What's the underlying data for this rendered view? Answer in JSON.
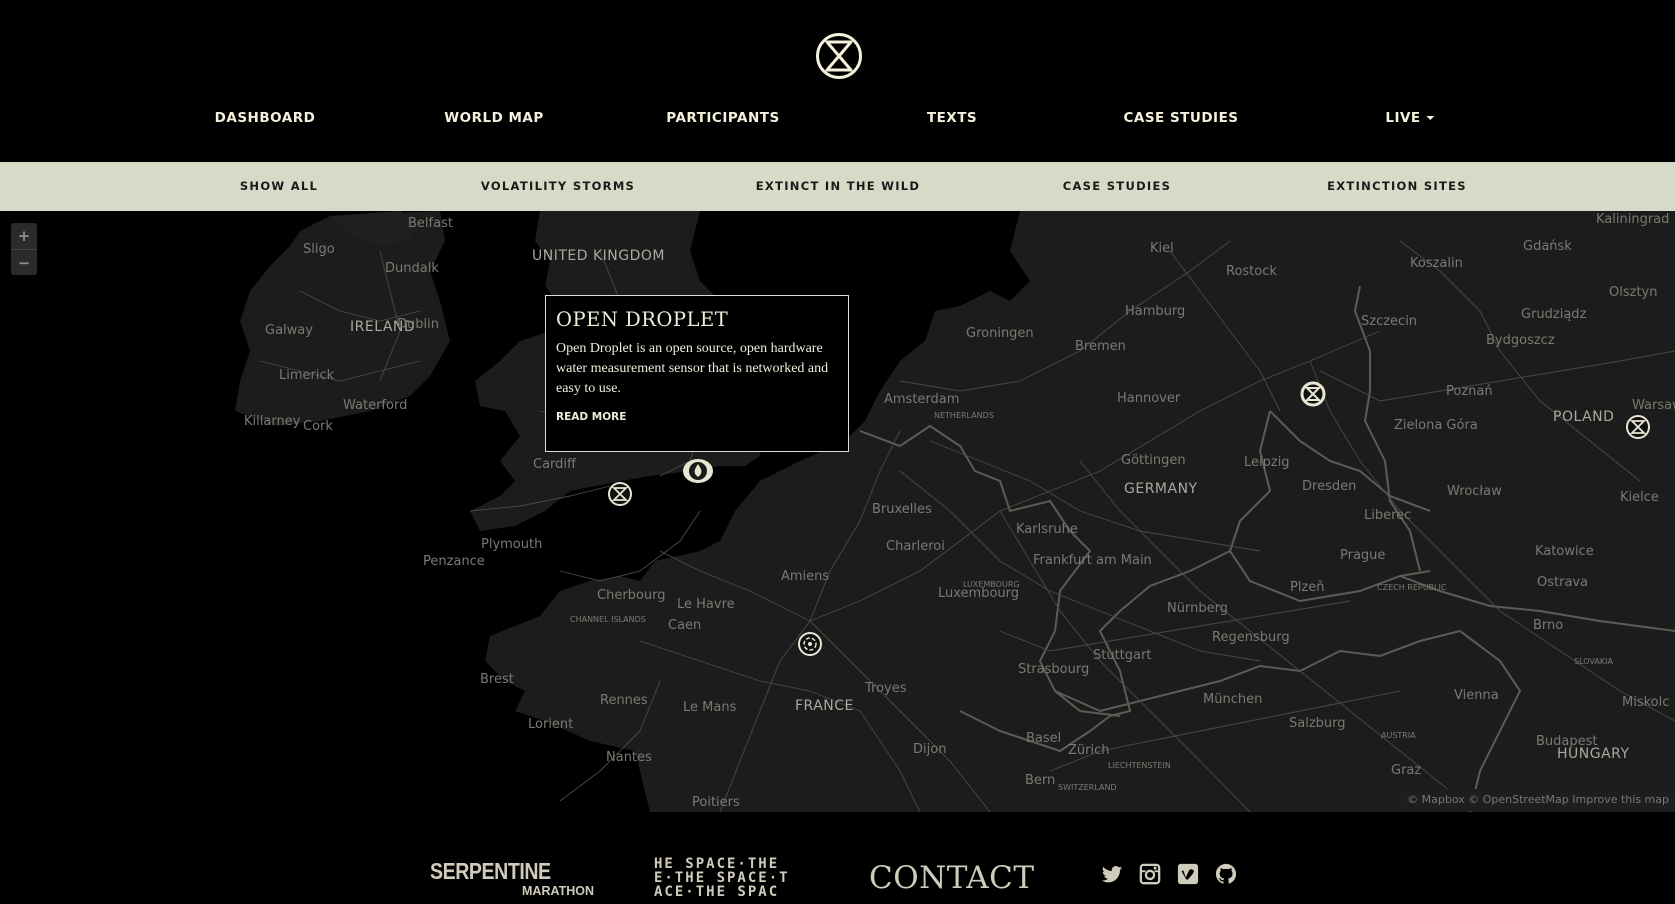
{
  "header": {
    "logo": "extinction-hourglass-icon",
    "nav": [
      {
        "label": "DASHBOARD"
      },
      {
        "label": "WORLD MAP"
      },
      {
        "label": "PARTICIPANTS"
      },
      {
        "label": "TEXTS"
      },
      {
        "label": "CASE STUDIES"
      },
      {
        "label": "LIVE",
        "dropdown": true
      }
    ]
  },
  "filters": [
    {
      "label": "SHOW ALL"
    },
    {
      "label": "VOLATILITY STORMS"
    },
    {
      "label": "EXTINCT IN THE WILD"
    },
    {
      "label": "CASE STUDIES"
    },
    {
      "label": "EXTINCTION SITES"
    }
  ],
  "map": {
    "zoom_in": "+",
    "zoom_out": "−",
    "attribution": "© Mapbox © OpenStreetMap Improve this map",
    "countries": [
      "UNITED KINGDOM",
      "IRELAND",
      "GERMANY",
      "FRANCE",
      "POLAND",
      "HUNGARY"
    ],
    "cities": [
      "Belfast",
      "Sligo",
      "Dundalk",
      "Galway",
      "Dublin",
      "Limerick",
      "Waterford",
      "Killarney",
      "Cork",
      "Cardiff",
      "Plymouth",
      "Penzance",
      "Cherbourg",
      "Le Havre",
      "Caen",
      "Amiens",
      "Brest",
      "Rennes",
      "Le Mans",
      "Lorient",
      "Nantes",
      "Poitiers",
      "Troyes",
      "Dijon",
      "Bern",
      "Zürich",
      "Basel",
      "Strasbourg",
      "Stuttgart",
      "Karlsruhe",
      "Frankfurt am Main",
      "Luxembourg",
      "Bruxelles",
      "Charleroi",
      "Amsterdam",
      "Groningen",
      "Bremen",
      "Hamburg",
      "Hannover",
      "Göttingen",
      "Kiel",
      "Rostock",
      "Szczecin",
      "Koszalin",
      "Gdańsk",
      "Kaliningrad",
      "Olsztyn",
      "Grudziądz",
      "Bydgoszcz",
      "Poznań",
      "Zielona Góra",
      "Wrocław",
      "Warsaw",
      "Kielce",
      "Leipzig",
      "Dresden",
      "Liberec",
      "Prague",
      "Plzeň",
      "Nürnberg",
      "Regensburg",
      "München",
      "Salzburg",
      "Katowice",
      "Ostrava",
      "Brno",
      "Vienna",
      "Miskolc",
      "Budapest",
      "Graz"
    ],
    "small_labels": [
      "CHANNEL ISLANDS",
      "CZECH REPUBLIC",
      "SLOVAKIA",
      "AUSTRIA",
      "LIECHTENSTEIN",
      "SWITZERLAND",
      "LUXEMBOURG",
      "NETHERLANDS"
    ],
    "marker_icons": [
      "extinction-marker-icon",
      "droplet-marker-icon",
      "extinction-marker-icon",
      "extinction-marker-icon",
      "storm-marker-icon"
    ],
    "popup": {
      "title": "OPEN DROPLET",
      "body": "Open Droplet is an open source, open hardware water measurement sensor that is networked and easy to use.",
      "link": "READ MORE"
    }
  },
  "footer": {
    "serpentine": {
      "name": "SERPENTINE",
      "sub": "MARATHON"
    },
    "thespace": [
      "HE SPACE·THE",
      "E·THE SPACE·T",
      "ACE·THE SPAC"
    ],
    "contact": "CONTACT",
    "social_icons": [
      "twitter-icon",
      "instagram-icon",
      "vimeo-icon",
      "github-icon"
    ]
  },
  "colors": {
    "background": "#000000",
    "filter_bar": "#d8d9c6",
    "cream": "#f0eddc",
    "land": "#1c1c1c"
  }
}
